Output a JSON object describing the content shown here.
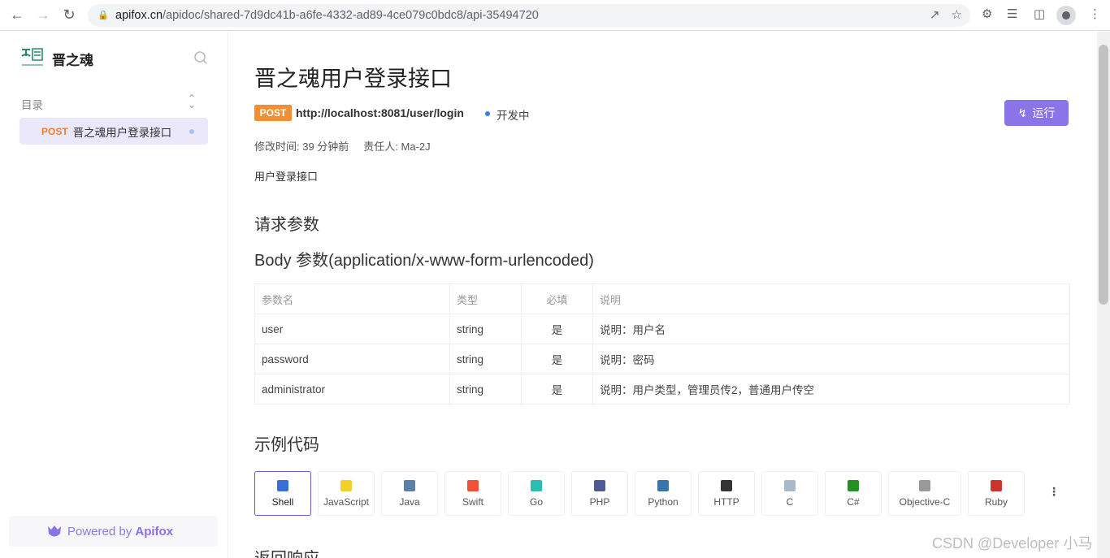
{
  "browser": {
    "url_host": "apifox.cn",
    "url_path": "/apidoc/shared-7d9dc41b-a6fe-4332-ad89-4ce079c0bdc8/api-35494720"
  },
  "sidebar": {
    "brand": "晋之魂",
    "toc_label": "目录",
    "items": [
      {
        "method": "POST",
        "title": "晋之魂用户登录接口"
      }
    ],
    "powered_prefix": "Powered by ",
    "powered_brand": "Apifox"
  },
  "api": {
    "title": "晋之魂用户登录接口",
    "method": "POST",
    "endpoint": "http://localhost:8081/user/login",
    "status": "开发中",
    "run_label": "运行",
    "modified": "修改时间: 39 分钟前",
    "owner": "责任人: Ma-2J",
    "description": "用户登录接口"
  },
  "request": {
    "heading": "请求参数",
    "body_heading": "Body 参数(application/x-www-form-urlencoded)",
    "columns": [
      "参数名",
      "类型",
      "必填",
      "说明"
    ],
    "rows": [
      [
        "user",
        "string",
        "是",
        "说明：用户名"
      ],
      [
        "password",
        "string",
        "是",
        "说明：密码"
      ],
      [
        "administrator",
        "string",
        "是",
        "说明：用户类型，管理员传2，普通用户传空"
      ]
    ]
  },
  "code": {
    "heading": "示例代码",
    "languages": [
      {
        "label": "Shell",
        "icon": "shell-icon",
        "color": "#3b6fd8"
      },
      {
        "label": "JavaScript",
        "icon": "javascript-icon",
        "color": "#f2d027"
      },
      {
        "label": "Java",
        "icon": "java-icon",
        "color": "#5b7fa8"
      },
      {
        "label": "Swift",
        "icon": "swift-icon",
        "color": "#f05138"
      },
      {
        "label": "Go",
        "icon": "go-icon",
        "color": "#29beb0"
      },
      {
        "label": "PHP",
        "icon": "php-icon",
        "color": "#4f5b93"
      },
      {
        "label": "Python",
        "icon": "python-icon",
        "color": "#3776ab"
      },
      {
        "label": "HTTP",
        "icon": "http-icon",
        "color": "#333333"
      },
      {
        "label": "C",
        "icon": "c-icon",
        "color": "#a8b9cc"
      },
      {
        "label": "C#",
        "icon": "csharp-icon",
        "color": "#239120"
      },
      {
        "label": "Objective-C",
        "icon": "objective-c-icon",
        "color": "#999999"
      },
      {
        "label": "Ruby",
        "icon": "ruby-icon",
        "color": "#cc342d"
      }
    ]
  },
  "response": {
    "heading": "返回响应"
  },
  "watermark": "CSDN @Developer 小马"
}
